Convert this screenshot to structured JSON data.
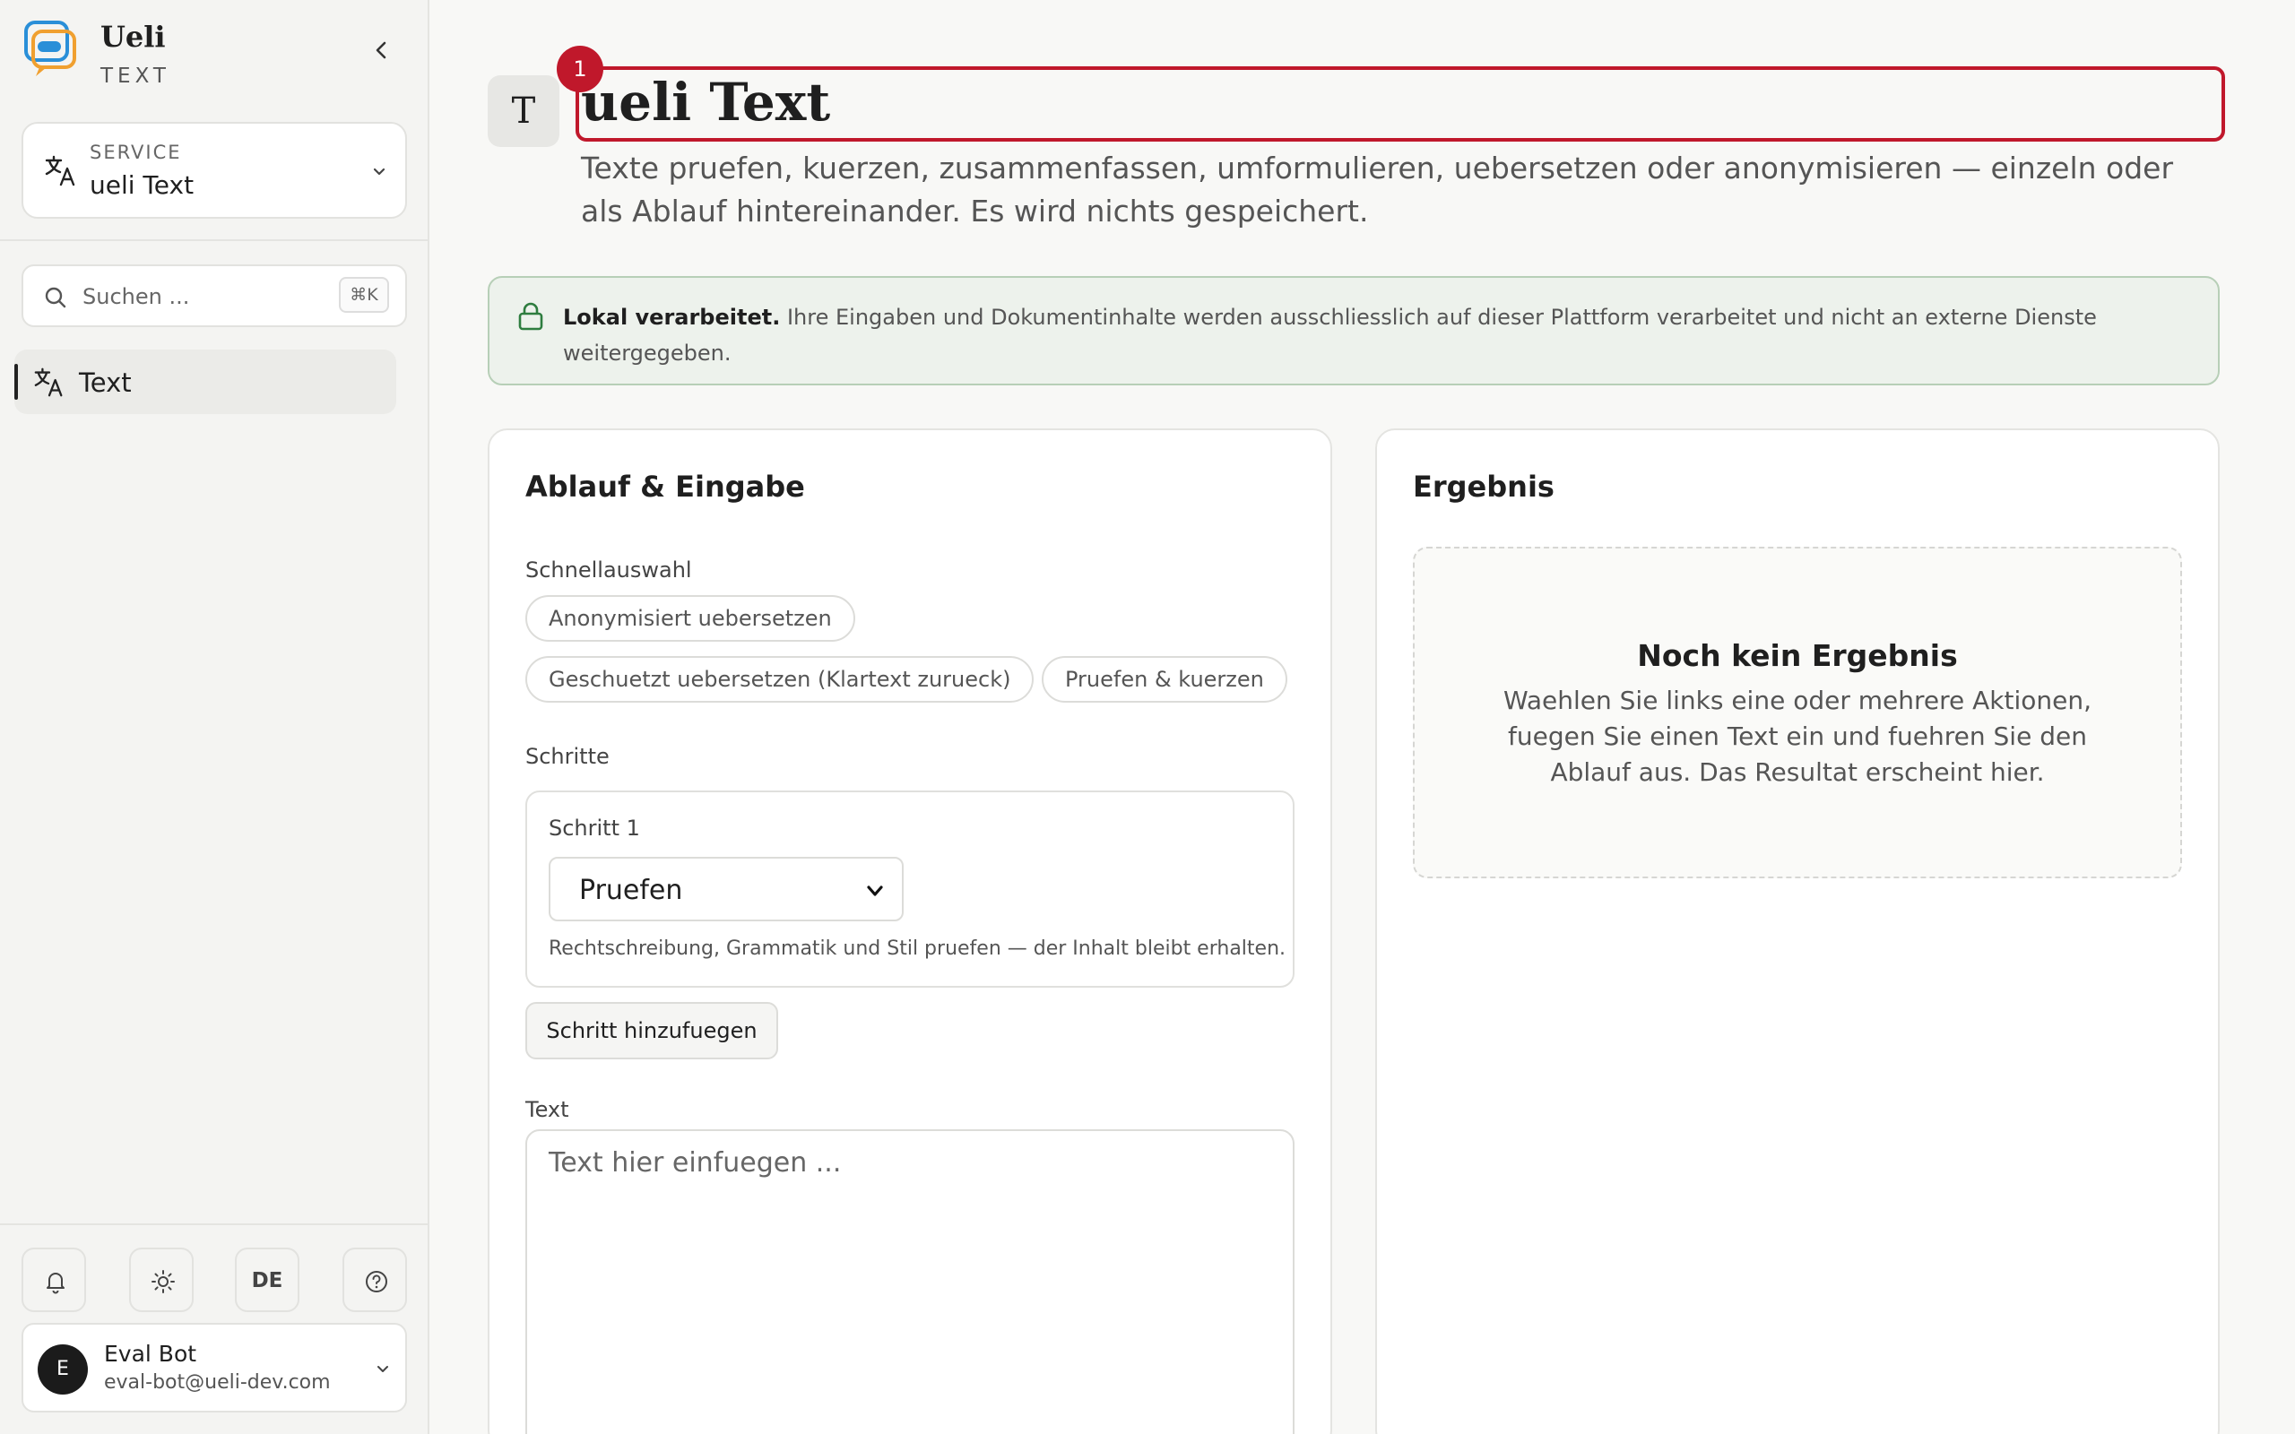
{
  "brand": {
    "name": "Ueli",
    "subtitle": "TEXT"
  },
  "sidebar": {
    "service": {
      "label": "SERVICE",
      "value": "ueli Text"
    },
    "search": {
      "placeholder": "Suchen ...",
      "shortcut": "⌘K"
    },
    "nav": [
      {
        "label": "Text",
        "icon": "translate-icon",
        "active": true
      }
    ],
    "tools": {
      "language": "DE"
    },
    "user": {
      "initial": "E",
      "name": "Eval Bot",
      "email": "eval-bot@ueli-dev.com"
    }
  },
  "page": {
    "icon_letter": "T",
    "badge": "1",
    "title": "ueli Text",
    "description": "Texte pruefen, kuerzen, zusammenfassen, umformulieren, uebersetzen oder anonymisieren — einzeln oder als Ablauf hintereinander. Es wird nichts gespeichert."
  },
  "notice": {
    "bold": "Lokal verarbeitet.",
    "text": " Ihre Eingaben und Dokumentinhalte werden ausschliesslich auf dieser Plattform verarbeitet und nicht an externe Dienste weitergegeben."
  },
  "input_card": {
    "title": "Ablauf & Eingabe",
    "quick_label": "Schnellauswahl",
    "quick_options": [
      "Anonymisiert uebersetzen",
      "Geschuetzt uebersetzen (Klartext zurueck)",
      "Pruefen & kuerzen"
    ],
    "steps_label": "Schritte",
    "step": {
      "label": "Schritt 1",
      "selected": "Pruefen",
      "help": "Rechtschreibung, Grammatik und Stil pruefen — der Inhalt bleibt erhalten."
    },
    "add_step": "Schritt hinzufuegen",
    "text_label": "Text",
    "text_placeholder": "Text hier einfuegen ..."
  },
  "result_card": {
    "title": "Ergebnis",
    "empty_title": "Noch kein Ergebnis",
    "empty_text": "Waehlen Sie links eine oder mehrere Aktionen, fuegen Sie einen Text ein und fuehren Sie den Ablauf aus. Das Resultat erscheint hier."
  },
  "colors": {
    "accent": "#c0182b",
    "notice_bg": "#edf2ec",
    "notice_border": "#b7cfb7"
  }
}
